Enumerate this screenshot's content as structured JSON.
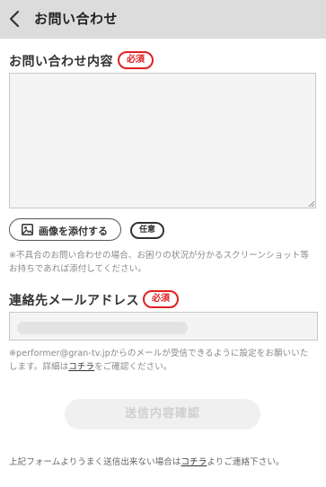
{
  "header": {
    "title": "お問い合わせ",
    "back_icon": "chevron-left-icon"
  },
  "inquiry": {
    "label": "お問い合わせ内容",
    "required_badge": "必須",
    "textarea_value": ""
  },
  "attachment": {
    "button_label": "画像を添付する",
    "button_icon": "image-icon",
    "optional_badge": "任意",
    "note_line1": "※不具合のお問い合わせの場合、お困りの状況が分かるスクリーンショット等",
    "note_line2": "お持ちであれば添付してください。"
  },
  "email": {
    "label": "連絡先メールアドレス",
    "required_badge": "必須",
    "note_line1": "※performer@gran-tv.jpからのメールが受信できるように設定をお願いいた",
    "note_line2_prefix": "します。詳細は",
    "note_link": "コチラ",
    "note_line2_suffix": "をご確認ください。"
  },
  "submit": {
    "label": "送信内容確認"
  },
  "footer": {
    "prefix": "上記フォームよりうまく送信出来ない場合は",
    "link": "コチラ",
    "suffix": "よりご連絡下さい。"
  },
  "colors": {
    "header_bg": "#dcdcdc",
    "required_red": "#e02020",
    "input_bg": "#f4f4f4",
    "note_gray": "#888888",
    "submit_disabled_bg": "#f0f0f0",
    "submit_disabled_text": "#cfcfcf"
  }
}
